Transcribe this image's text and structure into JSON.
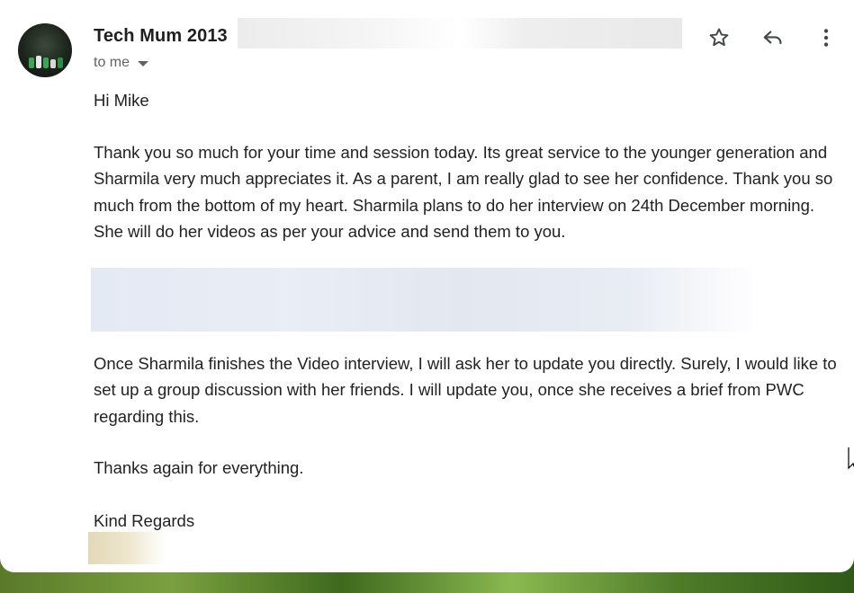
{
  "email": {
    "sender_name": "Tech Mum 2013",
    "recipient_label": "to me",
    "paragraphs": {
      "greeting": "Hi Mike",
      "p1": "Thank you so much for your time and session today. Its great service to the younger generation and Sharmila very much appreciates it. As a parent, I am really glad to see her confidence. Thank you so much from the bottom of my heart. Sharmila plans to do her interview on 24th December morning. She will do her videos as per your advice and send them to you.",
      "p2": "Once Sharmila finishes the Video interview, I will ask her to update you directly. Surely, I would like to set up a group discussion with her friends. I will update you, once she receives a brief from PWC regarding this.",
      "p3": "Thanks again for everything.",
      "closing": "Kind Regards"
    }
  },
  "toolbar": {
    "icons": [
      "star-icon",
      "reply-icon",
      "more-vert-icon"
    ]
  },
  "colors": {
    "text": "#222222",
    "secondary": "#5f6368",
    "icon": "#444746"
  }
}
